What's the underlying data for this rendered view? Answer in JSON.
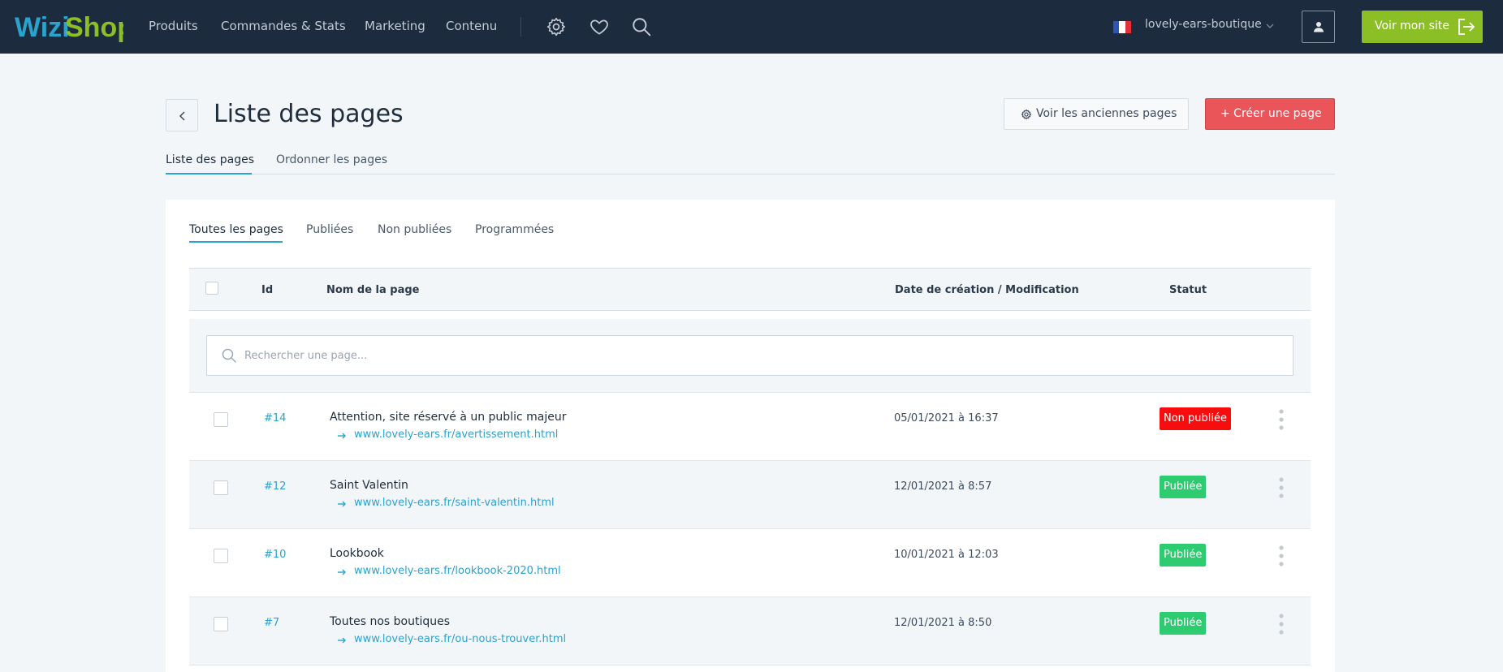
{
  "brand": {
    "logo_part1": "Wizi",
    "logo_part2": "Shop"
  },
  "nav": {
    "links": [
      "Produits",
      "Commandes & Stats",
      "Marketing",
      "Contenu"
    ],
    "icons": [
      "gear-icon",
      "heart-icon",
      "search-icon"
    ],
    "account": "lovely-ears-boutique",
    "view_site": "Voir mon site"
  },
  "header": {
    "title": "Liste des pages",
    "old_pages_button": "Voir les anciennes pages",
    "create_button": "+ Créer une page"
  },
  "tabs": [
    {
      "label": "Liste des pages",
      "active": true
    },
    {
      "label": "Ordonner les pages",
      "active": false
    }
  ],
  "subtabs": [
    {
      "label": "Toutes les pages",
      "active": true
    },
    {
      "label": "Publiées",
      "active": false
    },
    {
      "label": "Non publiées",
      "active": false
    },
    {
      "label": "Programmées",
      "active": false
    }
  ],
  "table": {
    "columns": {
      "id": "Id",
      "name": "Nom de la page",
      "date": "Date de création / Modification",
      "status": "Statut"
    },
    "search_placeholder": "Rechercher une page...",
    "rows": [
      {
        "id": "#14",
        "name": "Attention, site réservé à un public majeur",
        "url": "www.lovely-ears.fr/avertissement.html",
        "date": "05/01/2021 à 16:37",
        "status": "Non publiée"
      },
      {
        "id": "#12",
        "name": "Saint Valentin",
        "url": "www.lovely-ears.fr/saint-valentin.html",
        "date": "12/01/2021 à 8:57",
        "status": "Publiée"
      },
      {
        "id": "#10",
        "name": "Lookbook",
        "url": "www.lovely-ears.fr/lookbook-2020.html",
        "date": "10/01/2021 à 12:03",
        "status": "Publiée"
      },
      {
        "id": "#7",
        "name": "Toutes nos boutiques",
        "url": "www.lovely-ears.fr/ou-nous-trouver.html",
        "date": "12/01/2021 à 8:50",
        "status": "Publiée"
      }
    ]
  },
  "colors": {
    "nav_bg": "#1d2b3f",
    "accent": "#2aa3cf",
    "view_site_green": "#8cbf26",
    "create_red": "#ea5559",
    "published_green": "#2ecc71",
    "unpublished_red": "#f70d0d"
  }
}
